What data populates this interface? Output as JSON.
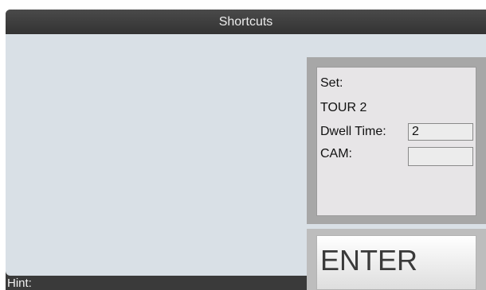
{
  "window": {
    "title": "Shortcuts",
    "hint_label": "Hint:"
  },
  "panel": {
    "set_label": "Set:",
    "set_value": "TOUR 2",
    "dwell_time_label": "Dwell Time:",
    "dwell_time_value": "2",
    "cam_label": "CAM:",
    "cam_value": ""
  },
  "actions": {
    "enter_label": "ENTER"
  },
  "colors": {
    "title_bar": "#3a3a3a",
    "content_background": "#d9e0e6",
    "panel_frame": "#a7a7a7",
    "panel_background": "#e7e5e7",
    "hint_text": "#f0f0f0"
  }
}
